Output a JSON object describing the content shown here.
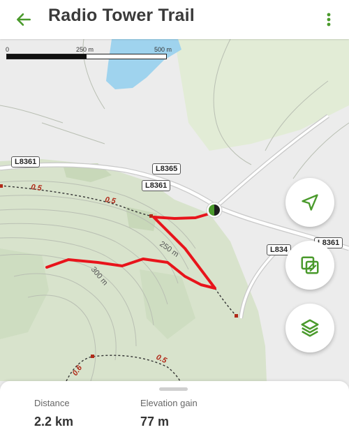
{
  "header": {
    "title": "Radio Tower Trail"
  },
  "scale_bar": {
    "labels": [
      "0",
      "250 m",
      "500 m"
    ]
  },
  "map": {
    "road_labels": [
      "L8361",
      "L8365",
      "L8361",
      "L834",
      "L8361"
    ],
    "contour_labels": [
      "250 m",
      "300 m"
    ],
    "distance_markers": [
      "0.5",
      "0.5",
      "0.6",
      "0.5"
    ]
  },
  "stats": {
    "distance": {
      "label": "Distance",
      "value": "2.2 km"
    },
    "elevation": {
      "label": "Elevation gain",
      "value": "77 m"
    }
  },
  "colors": {
    "brand_green": "#4a9a2c",
    "route_red": "#e8141b",
    "water": "#9fd3ee",
    "forest": "#d7e2cc"
  }
}
